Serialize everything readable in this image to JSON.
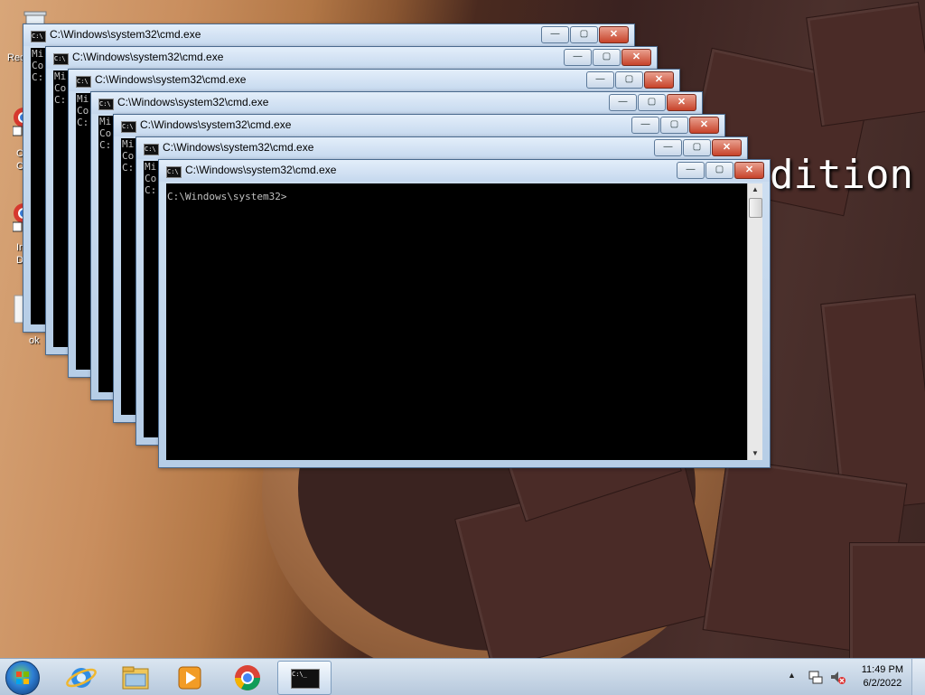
{
  "desktop": {
    "overlay_text": "dition",
    "icon_labels": [
      "Rec",
      "C",
      "C",
      "In",
      "De",
      "ok"
    ]
  },
  "windows": [
    {
      "title": "C:\\Windows\\system32\\cmd.exe",
      "lines": [
        "Mi",
        "Co",
        "",
        "C:"
      ]
    },
    {
      "title": "C:\\Windows\\system32\\cmd.exe",
      "lines": [
        "Mi",
        "Co",
        "",
        "C:"
      ]
    },
    {
      "title": "C:\\Windows\\system32\\cmd.exe",
      "lines": [
        "Mi",
        "Co",
        "",
        "C:"
      ]
    },
    {
      "title": "C:\\Windows\\system32\\cmd.exe",
      "lines": [
        "Mi",
        "Co",
        "",
        "C:"
      ]
    },
    {
      "title": "C:\\Windows\\system32\\cmd.exe",
      "lines": [
        "Mi",
        "Co",
        "",
        "C:"
      ]
    },
    {
      "title": "C:\\Windows\\system32\\cmd.exe",
      "lines": [
        "Mi",
        "Co",
        "",
        "C:"
      ]
    },
    {
      "title": "C:\\Windows\\system32\\cmd.exe",
      "lines": [
        "C:\\Windows\\system32>"
      ]
    }
  ],
  "buttons": {
    "minimize": "—",
    "maximize": "▢",
    "close": "✕"
  },
  "taskbar": {
    "apps": [
      "internet-explorer",
      "windows-explorer",
      "media-player",
      "chrome",
      "cmd"
    ],
    "cmd_icon_text": "C:\\_",
    "clock_time": "11:49 PM",
    "clock_date": "6/2/2022"
  }
}
